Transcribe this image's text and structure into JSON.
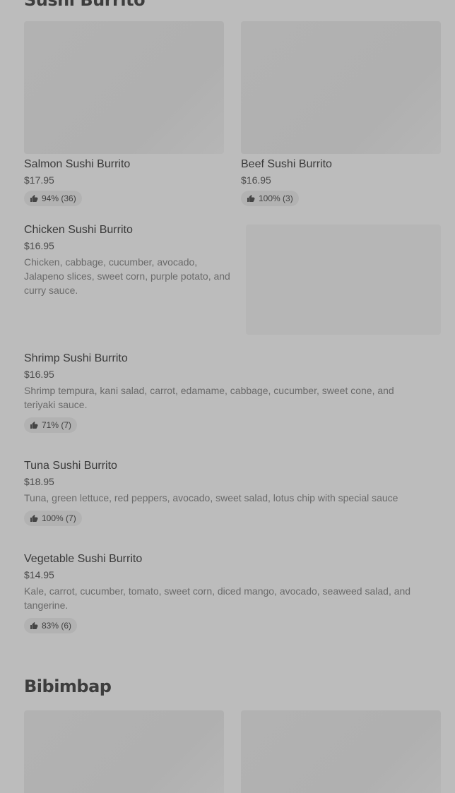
{
  "sections": [
    {
      "title": "Sushi Burrito"
    },
    {
      "title": "Bibimbap"
    }
  ],
  "featured": [
    {
      "name": "Salmon Sushi Burrito",
      "price": "$17.95",
      "rating": "94% (36)"
    },
    {
      "name": "Beef Sushi Burrito",
      "price": "$16.95",
      "rating": "100% (3)"
    }
  ],
  "items": [
    {
      "name": "Chicken Sushi Burrito",
      "price": "$16.95",
      "desc": "Chicken, cabbage, cucumber, avocado, Jalapeno slices, sweet corn, purple potato, and curry sauce."
    },
    {
      "name": "Shrimp Sushi Burrito",
      "price": "$16.95",
      "desc": "Shrimp tempura, kani salad, carrot, edamame, cabbage, cucumber, sweet cone, and teriyaki sauce.",
      "rating": "71% (7)"
    },
    {
      "name": "Tuna Sushi Burrito",
      "price": "$18.95",
      "desc": "Tuna, green lettuce, red peppers, avocado, sweet salad, lotus chip with special sauce",
      "rating": "100% (7)"
    },
    {
      "name": "Vegetable Sushi Burrito",
      "price": "$14.95",
      "desc": "Kale, carrot, cucumber, tomato, sweet corn, diced mango, avocado, seaweed salad, and tangerine.",
      "rating": "83% (6)"
    }
  ],
  "icons": {
    "rating": "thumbs-up-icon"
  },
  "colors": {
    "background": "#bcbcbc",
    "placeholder": "#b2b2b2",
    "text": "#3a3a3a"
  }
}
